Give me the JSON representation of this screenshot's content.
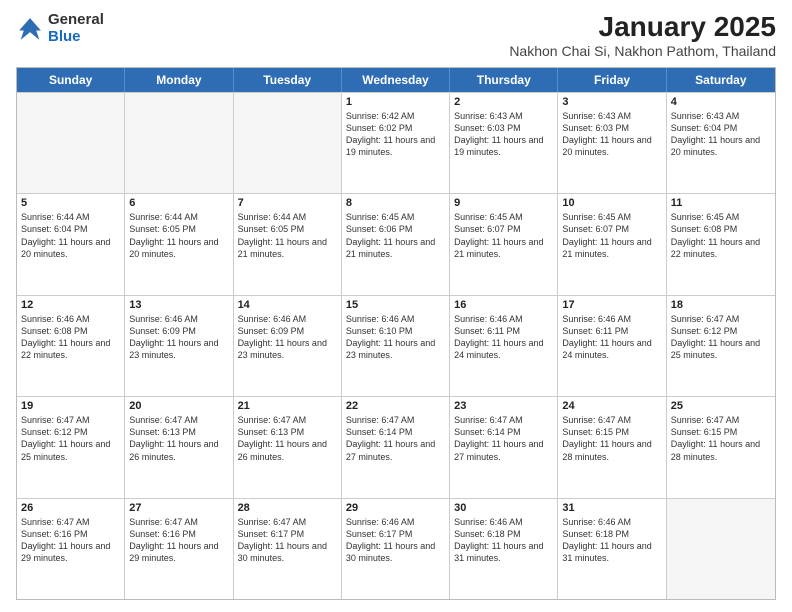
{
  "header": {
    "logo_general": "General",
    "logo_blue": "Blue",
    "title": "January 2025",
    "subtitle": "Nakhon Chai Si, Nakhon Pathom, Thailand"
  },
  "days_of_week": [
    "Sunday",
    "Monday",
    "Tuesday",
    "Wednesday",
    "Thursday",
    "Friday",
    "Saturday"
  ],
  "rows": [
    {
      "cells": [
        {
          "day": "",
          "info": "",
          "empty": true
        },
        {
          "day": "",
          "info": "",
          "empty": true
        },
        {
          "day": "",
          "info": "",
          "empty": true
        },
        {
          "day": "1",
          "info": "Sunrise: 6:42 AM\nSunset: 6:02 PM\nDaylight: 11 hours and 19 minutes."
        },
        {
          "day": "2",
          "info": "Sunrise: 6:43 AM\nSunset: 6:03 PM\nDaylight: 11 hours and 19 minutes."
        },
        {
          "day": "3",
          "info": "Sunrise: 6:43 AM\nSunset: 6:03 PM\nDaylight: 11 hours and 20 minutes."
        },
        {
          "day": "4",
          "info": "Sunrise: 6:43 AM\nSunset: 6:04 PM\nDaylight: 11 hours and 20 minutes."
        }
      ]
    },
    {
      "cells": [
        {
          "day": "5",
          "info": "Sunrise: 6:44 AM\nSunset: 6:04 PM\nDaylight: 11 hours and 20 minutes."
        },
        {
          "day": "6",
          "info": "Sunrise: 6:44 AM\nSunset: 6:05 PM\nDaylight: 11 hours and 20 minutes."
        },
        {
          "day": "7",
          "info": "Sunrise: 6:44 AM\nSunset: 6:05 PM\nDaylight: 11 hours and 21 minutes."
        },
        {
          "day": "8",
          "info": "Sunrise: 6:45 AM\nSunset: 6:06 PM\nDaylight: 11 hours and 21 minutes."
        },
        {
          "day": "9",
          "info": "Sunrise: 6:45 AM\nSunset: 6:07 PM\nDaylight: 11 hours and 21 minutes."
        },
        {
          "day": "10",
          "info": "Sunrise: 6:45 AM\nSunset: 6:07 PM\nDaylight: 11 hours and 21 minutes."
        },
        {
          "day": "11",
          "info": "Sunrise: 6:45 AM\nSunset: 6:08 PM\nDaylight: 11 hours and 22 minutes."
        }
      ]
    },
    {
      "cells": [
        {
          "day": "12",
          "info": "Sunrise: 6:46 AM\nSunset: 6:08 PM\nDaylight: 11 hours and 22 minutes."
        },
        {
          "day": "13",
          "info": "Sunrise: 6:46 AM\nSunset: 6:09 PM\nDaylight: 11 hours and 23 minutes."
        },
        {
          "day": "14",
          "info": "Sunrise: 6:46 AM\nSunset: 6:09 PM\nDaylight: 11 hours and 23 minutes."
        },
        {
          "day": "15",
          "info": "Sunrise: 6:46 AM\nSunset: 6:10 PM\nDaylight: 11 hours and 23 minutes."
        },
        {
          "day": "16",
          "info": "Sunrise: 6:46 AM\nSunset: 6:11 PM\nDaylight: 11 hours and 24 minutes."
        },
        {
          "day": "17",
          "info": "Sunrise: 6:46 AM\nSunset: 6:11 PM\nDaylight: 11 hours and 24 minutes."
        },
        {
          "day": "18",
          "info": "Sunrise: 6:47 AM\nSunset: 6:12 PM\nDaylight: 11 hours and 25 minutes."
        }
      ]
    },
    {
      "cells": [
        {
          "day": "19",
          "info": "Sunrise: 6:47 AM\nSunset: 6:12 PM\nDaylight: 11 hours and 25 minutes."
        },
        {
          "day": "20",
          "info": "Sunrise: 6:47 AM\nSunset: 6:13 PM\nDaylight: 11 hours and 26 minutes."
        },
        {
          "day": "21",
          "info": "Sunrise: 6:47 AM\nSunset: 6:13 PM\nDaylight: 11 hours and 26 minutes."
        },
        {
          "day": "22",
          "info": "Sunrise: 6:47 AM\nSunset: 6:14 PM\nDaylight: 11 hours and 27 minutes."
        },
        {
          "day": "23",
          "info": "Sunrise: 6:47 AM\nSunset: 6:14 PM\nDaylight: 11 hours and 27 minutes."
        },
        {
          "day": "24",
          "info": "Sunrise: 6:47 AM\nSunset: 6:15 PM\nDaylight: 11 hours and 28 minutes."
        },
        {
          "day": "25",
          "info": "Sunrise: 6:47 AM\nSunset: 6:15 PM\nDaylight: 11 hours and 28 minutes."
        }
      ]
    },
    {
      "cells": [
        {
          "day": "26",
          "info": "Sunrise: 6:47 AM\nSunset: 6:16 PM\nDaylight: 11 hours and 29 minutes."
        },
        {
          "day": "27",
          "info": "Sunrise: 6:47 AM\nSunset: 6:16 PM\nDaylight: 11 hours and 29 minutes."
        },
        {
          "day": "28",
          "info": "Sunrise: 6:47 AM\nSunset: 6:17 PM\nDaylight: 11 hours and 30 minutes."
        },
        {
          "day": "29",
          "info": "Sunrise: 6:46 AM\nSunset: 6:17 PM\nDaylight: 11 hours and 30 minutes."
        },
        {
          "day": "30",
          "info": "Sunrise: 6:46 AM\nSunset: 6:18 PM\nDaylight: 11 hours and 31 minutes."
        },
        {
          "day": "31",
          "info": "Sunrise: 6:46 AM\nSunset: 6:18 PM\nDaylight: 11 hours and 31 minutes."
        },
        {
          "day": "",
          "info": "",
          "empty": true
        }
      ]
    }
  ]
}
